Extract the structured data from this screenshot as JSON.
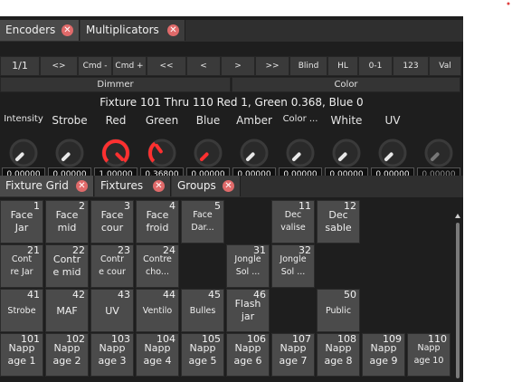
{
  "top_tabs": [
    {
      "label": "Encoders",
      "active": true
    },
    {
      "label": "Multiplicators",
      "active": false
    }
  ],
  "toolbar": [
    "1/1",
    "<>",
    "Cmd -",
    "Cmd +",
    "<<",
    "<",
    ">",
    ">>",
    "Blind",
    "HL",
    "0-1",
    "123",
    "Val"
  ],
  "groups": [
    "Dimmer",
    "Color"
  ],
  "fixture_line": "Fixture 101 Thru 110 Red 1, Green 0.368, Blue 0",
  "channels": [
    {
      "label": "Intensity",
      "value": "0.00000",
      "level": 0.0,
      "color": "#e8e8e8"
    },
    {
      "label": "Strobe",
      "value": "0.00000",
      "level": 0.0,
      "color": "#e8e8e8"
    },
    {
      "label": "Red",
      "value": "1.00000",
      "level": 1.0,
      "color": "#ff3030"
    },
    {
      "label": "Green",
      "value": "0.36800",
      "level": 0.368,
      "color": "#ff3030"
    },
    {
      "label": "Blue",
      "value": "0.00000",
      "level": 0.0,
      "color": "#ff3030"
    },
    {
      "label": "Amber",
      "value": "0.00000",
      "level": 0.0,
      "color": "#e8e8e8"
    },
    {
      "label": "Color ...",
      "value": "0.00000",
      "level": 0.0,
      "color": "#e8e8e8"
    },
    {
      "label": "White",
      "value": "0.00000",
      "level": 0.0,
      "color": "#e8e8e8"
    },
    {
      "label": "UV",
      "value": "0.00000",
      "level": 0.0,
      "color": "#e8e8e8"
    },
    {
      "label": "",
      "value": "0.00000",
      "level": 0.0,
      "color": "#777777"
    }
  ],
  "bottom_tabs": [
    {
      "label": "Fixture Grid",
      "active": true
    },
    {
      "label": "Fixtures",
      "active": false
    },
    {
      "label": "Groups",
      "active": false
    }
  ],
  "grid": [
    {
      "row": 0,
      "col": 0,
      "num": "1",
      "lines": [
        "Face",
        "Jar"
      ]
    },
    {
      "row": 0,
      "col": 1,
      "num": "2",
      "lines": [
        "Face",
        "mid"
      ]
    },
    {
      "row": 0,
      "col": 2,
      "num": "3",
      "lines": [
        "Face",
        "cour"
      ]
    },
    {
      "row": 0,
      "col": 3,
      "num": "4",
      "lines": [
        "Face",
        "froid"
      ]
    },
    {
      "row": 0,
      "col": 4,
      "num": "5",
      "lines": [
        "Face",
        "Dar..."
      ]
    },
    {
      "row": 0,
      "col": 6,
      "num": "11",
      "lines": [
        "Dec",
        "valise"
      ]
    },
    {
      "row": 0,
      "col": 7,
      "num": "12",
      "lines": [
        "Dec",
        "sable"
      ]
    },
    {
      "row": 1,
      "col": 0,
      "num": "21",
      "lines": [
        "Cont",
        "re Jar"
      ]
    },
    {
      "row": 1,
      "col": 1,
      "num": "22",
      "lines": [
        "Contr",
        "e mid"
      ]
    },
    {
      "row": 1,
      "col": 2,
      "num": "23",
      "lines": [
        "Contr",
        "e cour"
      ]
    },
    {
      "row": 1,
      "col": 3,
      "num": "24",
      "lines": [
        "Contre",
        "cho..."
      ]
    },
    {
      "row": 1,
      "col": 5,
      "num": "31",
      "lines": [
        "Jongle",
        "Sol ..."
      ]
    },
    {
      "row": 1,
      "col": 6,
      "num": "32",
      "lines": [
        "Jongle",
        "Sol ..."
      ]
    },
    {
      "row": 2,
      "col": 0,
      "num": "41",
      "lines": [
        "Strobe"
      ]
    },
    {
      "row": 2,
      "col": 1,
      "num": "42",
      "lines": [
        "MAF"
      ]
    },
    {
      "row": 2,
      "col": 2,
      "num": "43",
      "lines": [
        "UV"
      ]
    },
    {
      "row": 2,
      "col": 3,
      "num": "44",
      "lines": [
        "Ventilo"
      ]
    },
    {
      "row": 2,
      "col": 4,
      "num": "45",
      "lines": [
        "Bulles"
      ]
    },
    {
      "row": 2,
      "col": 5,
      "num": "46",
      "lines": [
        "Flash",
        "jar"
      ]
    },
    {
      "row": 2,
      "col": 7,
      "num": "50",
      "lines": [
        "Public"
      ]
    },
    {
      "row": 3,
      "col": 0,
      "num": "101",
      "lines": [
        "Napp",
        "age 1"
      ]
    },
    {
      "row": 3,
      "col": 1,
      "num": "102",
      "lines": [
        "Napp",
        "age 2"
      ]
    },
    {
      "row": 3,
      "col": 2,
      "num": "103",
      "lines": [
        "Napp",
        "age 3"
      ]
    },
    {
      "row": 3,
      "col": 3,
      "num": "104",
      "lines": [
        "Napp",
        "age 4"
      ]
    },
    {
      "row": 3,
      "col": 4,
      "num": "105",
      "lines": [
        "Napp",
        "age 5"
      ]
    },
    {
      "row": 3,
      "col": 5,
      "num": "106",
      "lines": [
        "Napp",
        "age 6"
      ]
    },
    {
      "row": 3,
      "col": 6,
      "num": "107",
      "lines": [
        "Napp",
        "age 7"
      ]
    },
    {
      "row": 3,
      "col": 7,
      "num": "108",
      "lines": [
        "Napp",
        "age 8"
      ]
    },
    {
      "row": 3,
      "col": 8,
      "num": "109",
      "lines": [
        "Napp",
        "age 9"
      ]
    },
    {
      "row": 3,
      "col": 9,
      "num": "110",
      "lines": [
        "Napp",
        "age 10"
      ]
    }
  ]
}
